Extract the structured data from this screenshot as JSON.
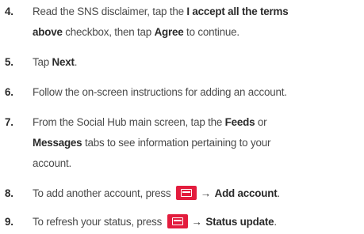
{
  "steps": [
    {
      "number": "4.",
      "lines": [
        [
          "Read the SNS disclaimer, tap the ",
          {
            "b": "I accept all the terms"
          }
        ],
        [
          {
            "b": "above"
          },
          " checkbox, then tap ",
          {
            "b": "Agree"
          },
          " to continue."
        ]
      ]
    },
    {
      "number": "5.",
      "lines": [
        [
          "Tap ",
          {
            "b": "Next"
          },
          "."
        ]
      ]
    },
    {
      "number": "6.",
      "lines": [
        [
          "Follow the on-screen instructions for adding an account."
        ]
      ]
    },
    {
      "number": "7.",
      "lines": [
        [
          "From the Social Hub main screen, tap the ",
          {
            "b": "Feeds"
          },
          " or"
        ],
        [
          {
            "b": "Messages"
          },
          " tabs to see information pertaining to your"
        ],
        [
          "account."
        ]
      ]
    },
    {
      "number": "8.",
      "lines": [
        [
          "To add another account, press ",
          {
            "icon": "menu-key-icon"
          },
          {
            "arrow": "→"
          },
          {
            "b": "Add account"
          },
          "."
        ]
      ]
    },
    {
      "number": "9.",
      "lines": [
        [
          "To refresh your status, press ",
          {
            "icon": "menu-key-icon"
          },
          {
            "arrow": "→"
          },
          {
            "b": "Status update"
          },
          "."
        ]
      ]
    }
  ],
  "colors": {
    "menu_key": "#e31c3d",
    "body_text": "#4a4a4a",
    "bold_text": "#2a2a2a"
  }
}
